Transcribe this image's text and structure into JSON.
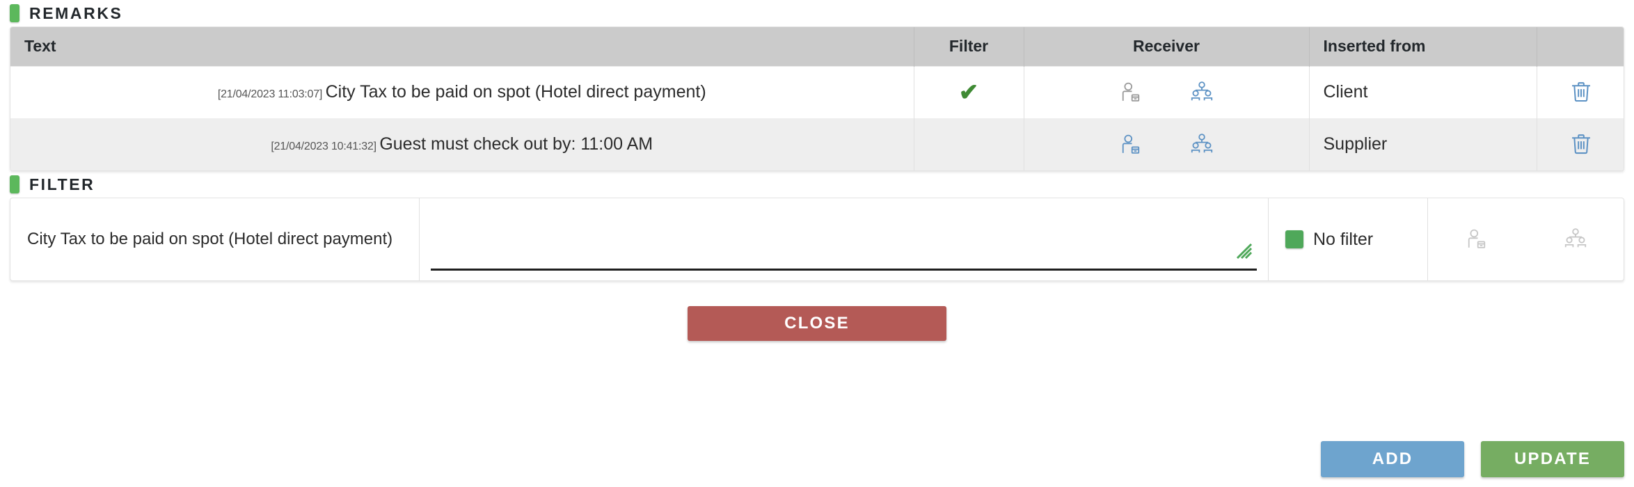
{
  "remarks_section": {
    "title": "REMARKS",
    "accent_color": "#5cb85c",
    "columns": [
      "Text",
      "Filter",
      "Receiver",
      "Inserted from",
      ""
    ],
    "rows": [
      {
        "timestamp": "[21/04/2023 11:03:07]",
        "text": "City Tax to be paid on spot (Hotel direct payment)",
        "filter_checked": "✔",
        "receiver_person_state": "inactive",
        "receiver_group_state": "active",
        "inserted_from": "Client",
        "delete_icon": "trash-icon"
      },
      {
        "timestamp": "[21/04/2023 10:41:32]",
        "text": "Guest must check out by: 11:00 AM",
        "filter_checked": "",
        "receiver_person_state": "active",
        "receiver_group_state": "active",
        "inserted_from": "Supplier",
        "delete_icon": "trash-icon"
      }
    ]
  },
  "filter_section": {
    "title": "FILTER",
    "accent_color": "#5cb85c",
    "remark_label": "City Tax to be paid on spot (Hotel direct payment)",
    "textarea_value": "",
    "textarea_placeholder": "",
    "no_filter_label": "No filter",
    "no_filter_color": "#4fa85a",
    "receiver_person_state": "inactive",
    "receiver_group_state": "inactive"
  },
  "buttons": {
    "close": "CLOSE",
    "add": "ADD",
    "update": "UPDATE",
    "close_color": "#b45a56",
    "add_color": "#6ea4ce",
    "update_color": "#76ad62"
  }
}
